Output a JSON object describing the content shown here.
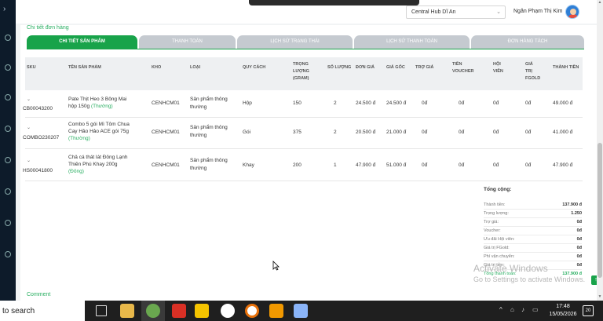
{
  "header": {
    "hub_select_value": "Central Hub Dĩ An",
    "user_name": "Ngân Phạm Thị Kim"
  },
  "page": {
    "section_title": "Chi tiết đơn hàng",
    "tabs": [
      {
        "label": "Chi tiết sản phẩm",
        "active": true
      },
      {
        "label": "Thanh toán",
        "active": false
      },
      {
        "label": "Lịch sử trạng thái",
        "active": false
      },
      {
        "label": "Lịch sử thanh toán",
        "active": false
      },
      {
        "label": "Đơn hàng tách",
        "active": false
      }
    ],
    "comment_label": "Comment"
  },
  "table": {
    "headers": {
      "sku": "SKU",
      "name": "Tên sản phẩm",
      "kho": "Kho",
      "loai": "Loại",
      "quy_cach": "Quy cách",
      "trong_luong_1": "Trọng",
      "trong_luong_2": "lượng",
      "trong_luong_3": "(gram)",
      "so_luong": "Số lượng",
      "don_gia": "Đơn giá",
      "gia_goc": "Giá gốc",
      "tro_gia": "Trợ giá",
      "tien_voucher_1": "Tiền",
      "tien_voucher_2": "voucher",
      "hoi_vien_1": "Hội",
      "hoi_vien_2": "viên",
      "gia_tri_1": "Giá",
      "gia_tri_2": "trị",
      "gia_tri_3": "FGold",
      "thanh_tien": "Thành tiền"
    },
    "rows": [
      {
        "sku": "CB00043200",
        "name_1": "Pate Thịt Heo 3 Bông Mai",
        "name_2": "hộp 150g",
        "tag": "(Thường)",
        "kho": "CENHCM01",
        "loai_1": "Sản phẩm thông",
        "loai_2": "thường",
        "quy_cach": "Hộp",
        "trong_luong": "150",
        "so_luong": "2",
        "don_gia": "24.500 đ",
        "gia_goc": "24.500 đ",
        "tro_gia": "0đ",
        "tien_voucher": "0đ",
        "hoi_vien": "0đ",
        "gia_tri": "0đ",
        "thanh_tien": "49.000 đ"
      },
      {
        "sku": "COMBO230207",
        "name_1": "Combo 5 gói Mì Tôm Chua",
        "name_2": "Cay Hảo Hảo ACE gói 75g",
        "tag": "(Thường)",
        "kho": "CENHCM01",
        "loai_1": "Sản phẩm thông",
        "loai_2": "thường",
        "quy_cach": "Gói",
        "trong_luong": "375",
        "so_luong": "2",
        "don_gia": "20.500 đ",
        "gia_goc": "21.000 đ",
        "tro_gia": "0đ",
        "tien_voucher": "0đ",
        "hoi_vien": "0đ",
        "gia_tri": "0đ",
        "thanh_tien": "41.000 đ"
      },
      {
        "sku": "HS00041800",
        "name_1": "Chả cá thát lát Đông Lạnh",
        "name_2": "Thiên Phú Khay 200g",
        "tag": "(Đông)",
        "kho": "CENHCM01",
        "loai_1": "Sản phẩm thông",
        "loai_2": "thường",
        "quy_cach": "Khay",
        "trong_luong": "200",
        "so_luong": "1",
        "don_gia": "47.900 đ",
        "gia_goc": "51.000 đ",
        "tro_gia": "0đ",
        "tien_voucher": "0đ",
        "hoi_vien": "0đ",
        "gia_tri": "0đ",
        "thanh_tien": "47.900 đ"
      }
    ]
  },
  "summary": {
    "title": "Tổng cộng:",
    "rows": [
      {
        "label": "Thành tiền:",
        "value": "137.900 đ"
      },
      {
        "label": "Trọng lượng:",
        "value": "1.250"
      },
      {
        "label": "Trợ giá:",
        "value": "0đ"
      },
      {
        "label": "Voucher:",
        "value": "0đ"
      },
      {
        "label": "Ưu đãi Hội viên:",
        "value": "0đ"
      },
      {
        "label": "Giá trị FGold:",
        "value": "0đ"
      },
      {
        "label": "Phí vận chuyển:",
        "value": "0đ"
      },
      {
        "label": "Giá trị tiền:",
        "value": "0đ"
      },
      {
        "label": "Tổng thanh toán:",
        "value": "137.900 đ"
      }
    ]
  },
  "overlay": {
    "activate_line1": "Activate Windows",
    "activate_line2": "Go to Settings to activate Windows."
  },
  "taskbar": {
    "search_text": "to search",
    "time": "17:48",
    "date": "15/05/2026",
    "notification_count": "20",
    "icons": [
      "task-view-icon",
      "file-explorer-icon",
      "browser-icon",
      "wps-icon",
      "sticky-notes-icon",
      "zalo-icon",
      "chrome-icon",
      "app-orange-icon",
      "app-blue-icon"
    ]
  },
  "colors": {
    "accent_green": "#18a34a",
    "tab_inactive": "#c5cad0",
    "sidebar": "#0d1b2a",
    "taskbar": "#1f1f1f"
  }
}
